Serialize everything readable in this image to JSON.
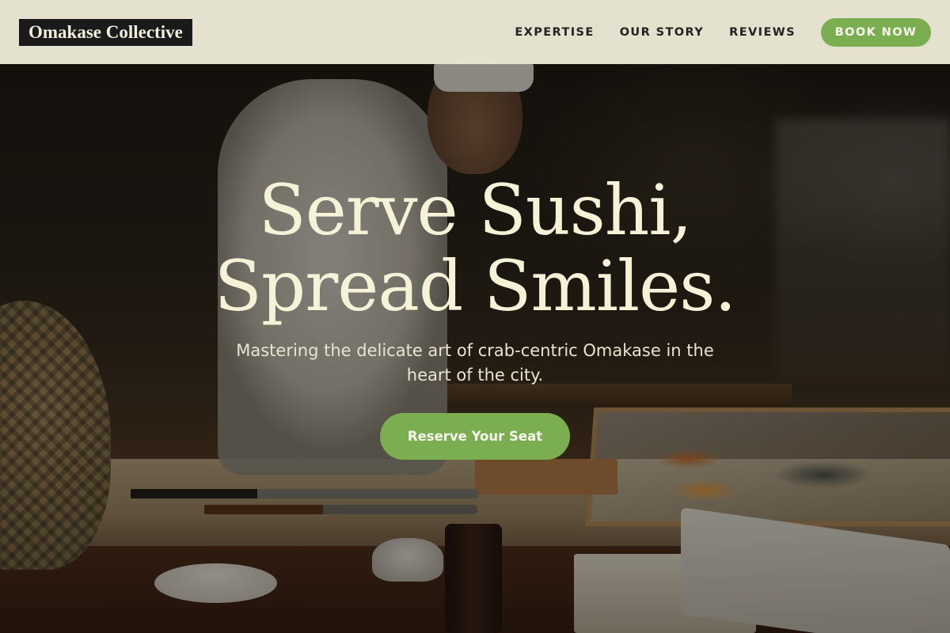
{
  "header": {
    "logo_text": "Omakase Collective",
    "nav": [
      {
        "label": "EXPERTISE"
      },
      {
        "label": "OUR STORY"
      },
      {
        "label": "REVIEWS"
      }
    ],
    "book_button": "BOOK NOW"
  },
  "hero": {
    "headline_line1": "Serve Sushi,",
    "headline_line2": "Spread Smiles.",
    "subtext": "Mastering the delicate art of crab-centric Omakase in the heart of the city.",
    "cta_label": "Reserve Your Seat",
    "background_image_alt": "chef-preparing-sushi-photo"
  },
  "colors": {
    "nav_background": "#EBE9D6",
    "accent_green": "#7BAE50",
    "headline_cream": "#F6F2D8",
    "logo_background": "#1A1A1A"
  }
}
